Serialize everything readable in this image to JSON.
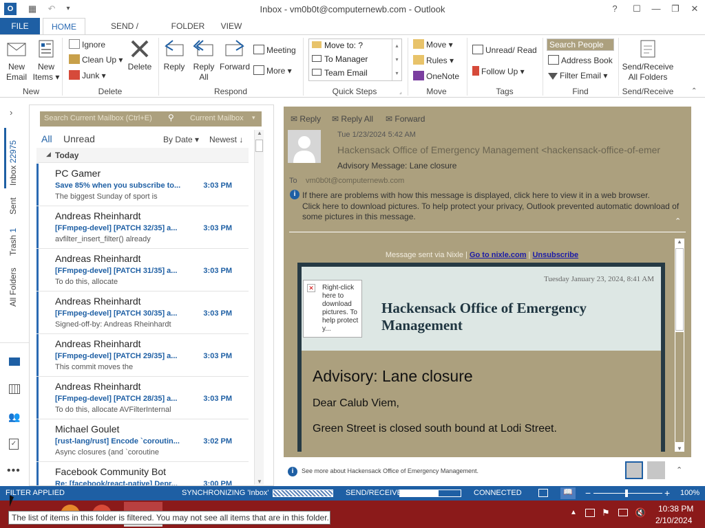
{
  "window": {
    "title": "Inbox - vm0b0t@computernewb.com - Outlook",
    "buttons": [
      "?",
      "☐",
      "—",
      "❐",
      "✕"
    ]
  },
  "tabs": [
    "FILE",
    "HOME",
    "SEND / RECEIVE",
    "FOLDER",
    "VIEW"
  ],
  "ribbon": {
    "new": {
      "label": "New",
      "new_email": [
        "New",
        "Email"
      ],
      "new_items": [
        "New",
        "Items ▾"
      ]
    },
    "delete": {
      "label": "Delete",
      "ignore": "Ignore",
      "cleanup": "Clean Up ▾",
      "junk": "Junk ▾",
      "delete": "Delete"
    },
    "respond": {
      "label": "Respond",
      "reply": "Reply",
      "reply_all": [
        "Reply",
        "All"
      ],
      "forward": "Forward",
      "meeting": "Meeting",
      "more": "More ▾"
    },
    "quicksteps": {
      "label": "Quick Steps",
      "items": [
        "Move to: ?",
        "To Manager",
        "Team Email"
      ]
    },
    "move": {
      "label": "Move",
      "move": "Move ▾",
      "rules": "Rules ▾",
      "onenote": "OneNote"
    },
    "tags": {
      "label": "Tags",
      "unread_read": "Unread/ Read",
      "follow_up": "Follow Up ▾"
    },
    "find": {
      "label": "Find",
      "search_people": "Search People",
      "address_book": "Address Book",
      "filter_email": "Filter Email ▾"
    },
    "sendreceive": {
      "label": "Send/Receive",
      "send_receive_all": [
        "Send/Receive",
        "All Folders"
      ]
    }
  },
  "rail": {
    "inbox": "Inbox",
    "inbox_count": "22975",
    "sent": "Sent",
    "trash": "Trash",
    "trash_count": "1",
    "all_folders": "All Folders"
  },
  "list": {
    "search_placeholder": "Search Current Mailbox (Ctrl+E)",
    "scope": "Current Mailbox",
    "filter_all": "All",
    "filter_unread": "Unread",
    "sort_by": "By Date ▾",
    "sort_order": "Newest ↓",
    "group": "Today",
    "messages": [
      {
        "from": "PC Gamer",
        "subject": "Save 85% when you subscribe to...",
        "time": "3:03 PM",
        "preview": "The biggest Sunday of sport is"
      },
      {
        "from": "Andreas Rheinhardt",
        "subject": "[FFmpeg-devel] [PATCH 32/35] a...",
        "time": "3:03 PM",
        "preview": "avfilter_insert_filter() already"
      },
      {
        "from": "Andreas Rheinhardt",
        "subject": "[FFmpeg-devel] [PATCH 31/35] a...",
        "time": "3:03 PM",
        "preview": "To do this, allocate"
      },
      {
        "from": "Andreas Rheinhardt",
        "subject": "[FFmpeg-devel] [PATCH 30/35] a...",
        "time": "3:03 PM",
        "preview": "Signed-off-by: Andreas Rheinhardt"
      },
      {
        "from": "Andreas Rheinhardt",
        "subject": "[FFmpeg-devel] [PATCH 29/35] a...",
        "time": "3:03 PM",
        "preview": "This commit moves the"
      },
      {
        "from": "Andreas Rheinhardt",
        "subject": "[FFmpeg-devel] [PATCH 28/35] a...",
        "time": "3:03 PM",
        "preview": "To do this, allocate AVFilterInternal"
      },
      {
        "from": "Michael Goulet",
        "subject": "[rust-lang/rust] Encode `coroutin...",
        "time": "3:02 PM",
        "preview": "Async closures (and `coroutine"
      },
      {
        "from": "Facebook Community Bot",
        "subject": "Re: [facebook/react-native] Depr...",
        "time": "3:00 PM",
        "preview": ""
      }
    ]
  },
  "reading": {
    "actions": [
      "Reply",
      "Reply All",
      "Forward"
    ],
    "date": "Tue 1/23/2024 5:42 AM",
    "sender": "Hackensack Office of Emergency Management <hackensack-office-of-emer",
    "subject": "Advisory Message: Lane closure",
    "to_label": "To",
    "to_value": "vm0b0t@computernewb.com",
    "info1": "If there are problems with how this message is displayed, click here to view it in a web browser.",
    "info2": "Click here to download pictures. To help protect your privacy, Outlook prevented automatic download of some pictures in this message.",
    "nixle_text": "Message sent via Nixle |",
    "nixle_link1": "Go to nixle.com",
    "nixle_sep": "|",
    "nixle_link2": "Unsubscribe",
    "card_date": "Tuesday January 23, 2024, 8:41 AM",
    "img_placeholder": "Right-click here to download pictures. To help protect y...",
    "org_name": "Hackensack Office of Emergency Management",
    "advisory_title": "Advisory: Lane closure",
    "greeting": "Dear Calub Viem,",
    "body1": "Green Street is closed south  bound at Lodi Street.",
    "footer_note": "See more about Hackensack Office of Emergency Management."
  },
  "status": {
    "filter": "FILTER APPLIED",
    "sync": "SYNCHRONIZING  'Inbox'",
    "send_receive": "SEND/RECEIVE",
    "connected": "CONNECTED",
    "zoom": "100%"
  },
  "taskbar": {
    "time": "10:38 PM",
    "date": "2/10/2024"
  },
  "tooltip": "The list of items in this folder is filtered. You may not see all items that are in this folder.",
  "colors": {
    "accent": "#1e5fa4",
    "reading_bg": "#aca07e",
    "taskbar": "#8b1a1a"
  }
}
